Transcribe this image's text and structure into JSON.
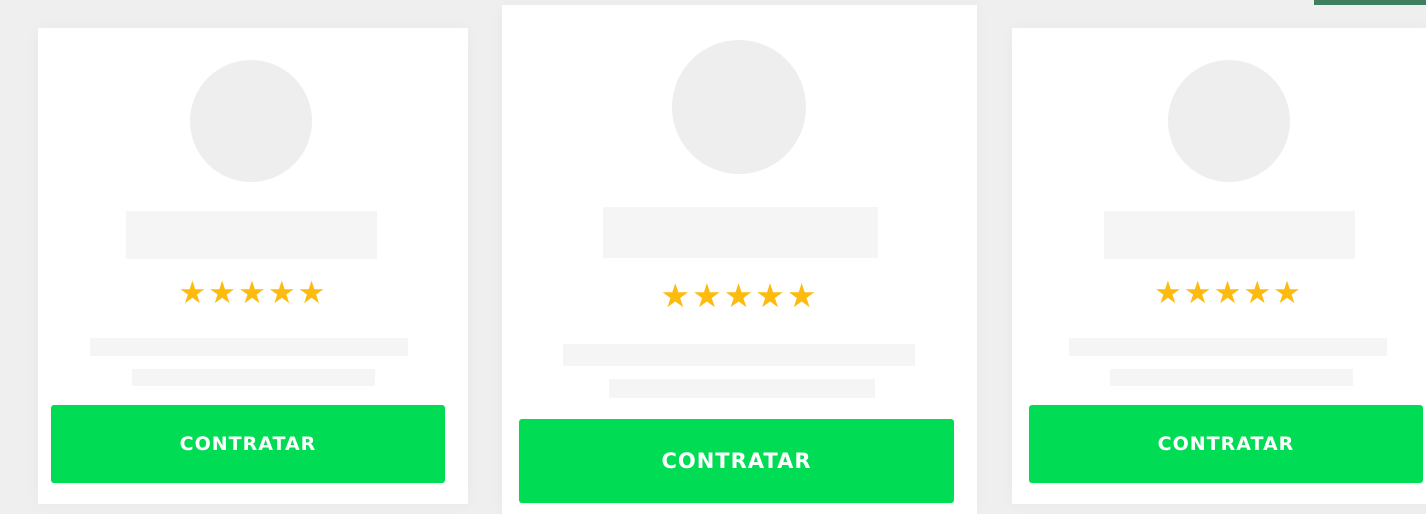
{
  "theme": {
    "accent": "#00dc54",
    "star_color": "#fdbb0f",
    "skeleton_color": "#f5f5f5",
    "avatar_color": "#eeeeee",
    "background": "#efefef"
  },
  "cards": [
    {
      "rating": 5,
      "stars": "★★★★★",
      "button_label": "CONTRATAR"
    },
    {
      "rating": 5,
      "stars": "★★★★★",
      "button_label": "CONTRATAR"
    },
    {
      "rating": 5,
      "stars": "★★★★★",
      "button_label": "CONTRATAR"
    }
  ]
}
